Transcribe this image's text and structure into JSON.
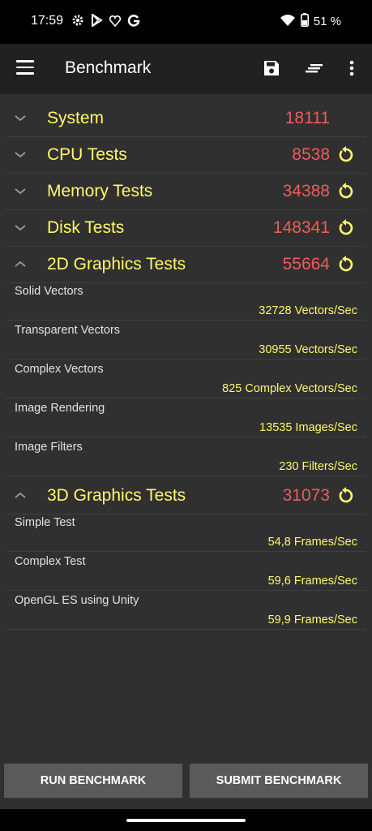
{
  "status": {
    "time": "17:59",
    "battery": "51 %",
    "icons": [
      "gear-icon",
      "play-store-icon",
      "heart-shield-icon",
      "google-g-icon",
      "wifi-icon",
      "battery-icon"
    ]
  },
  "appbar": {
    "title": "Benchmark",
    "icons": [
      "hamburger-menu-icon",
      "save-icon",
      "sort-icon",
      "more-vert-icon"
    ]
  },
  "categories": [
    {
      "name": "System",
      "score": "18111",
      "expanded": false,
      "reload": false
    },
    {
      "name": "CPU Tests",
      "score": "8538",
      "expanded": false,
      "reload": true
    },
    {
      "name": "Memory Tests",
      "score": "34388",
      "expanded": false,
      "reload": true
    },
    {
      "name": "Disk Tests",
      "score": "148341",
      "expanded": false,
      "reload": true
    },
    {
      "name": "2D Graphics Tests",
      "score": "55664",
      "expanded": true,
      "reload": true
    },
    {
      "name": "3D Graphics Tests",
      "score": "31073",
      "expanded": true,
      "reload": true
    }
  ],
  "tests_2d": [
    {
      "label": "Solid Vectors",
      "value": "32728 Vectors/Sec"
    },
    {
      "label": "Transparent Vectors",
      "value": "30955 Vectors/Sec"
    },
    {
      "label": "Complex Vectors",
      "value": "825 Complex Vectors/Sec"
    },
    {
      "label": "Image Rendering",
      "value": "13535 Images/Sec"
    },
    {
      "label": "Image Filters",
      "value": "230 Filters/Sec"
    }
  ],
  "tests_3d": [
    {
      "label": "Simple Test",
      "value": "54,8 Frames/Sec"
    },
    {
      "label": "Complex Test",
      "value": "59,6 Frames/Sec"
    },
    {
      "label": "OpenGL ES using Unity",
      "value": "59,9 Frames/Sec"
    }
  ],
  "buttons": {
    "run": "RUN BENCHMARK",
    "submit": "SUBMIT BENCHMARK"
  },
  "colors": {
    "category_name": "#fff86a",
    "score": "#f05b5b",
    "value": "#fff86a",
    "background": "#303030",
    "appbar": "#212121"
  }
}
